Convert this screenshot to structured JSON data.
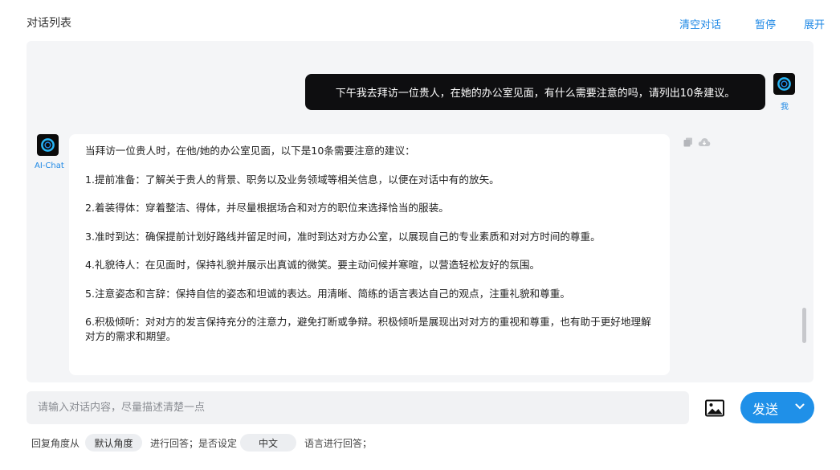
{
  "header": {
    "title": "对话列表",
    "actions": {
      "clear": "清空对话",
      "pause": "暂停",
      "expand": "展开"
    }
  },
  "chat": {
    "user": {
      "label": "我",
      "message": "下午我去拜访一位贵人，在她的办公室见面，有什么需要注意的吗，请列出10条建议。"
    },
    "ai": {
      "label": "AI-Chat",
      "paragraphs": [
        "当拜访一位贵人时，在他/她的办公室见面，以下是10条需要注意的建议：",
        "1.提前准备：了解关于贵人的背景、职务以及业务领域等相关信息，以便在对话中有的放矢。",
        "2.着装得体：穿着整洁、得体，并尽量根据场合和对方的职位来选择恰当的服装。",
        "3.准时到达：确保提前计划好路线并留足时间，准时到达对方办公室，以展现自己的专业素质和对对方时间的尊重。",
        "4.礼貌待人：在见面时，保持礼貌并展示出真诚的微笑。要主动问候并寒暄，以营造轻松友好的氛围。",
        "5.注意姿态和言辞：保持自信的姿态和坦诚的表达。用清晰、简练的语言表达自己的观点，注重礼貌和尊重。",
        "6.积极倾听：对对方的发言保持充分的注意力，避免打断或争辩。积极倾听是展现出对对方的重视和尊重，也有助于更好地理解对方的需求和期望。"
      ]
    },
    "icons": {
      "copy": "copy-icon",
      "download": "cloud-download-icon",
      "avatar": "ai-logo-icon"
    }
  },
  "input": {
    "placeholder": "请输入对话内容，尽量描述清楚一点",
    "value": ""
  },
  "send": {
    "label": "发送"
  },
  "options": {
    "prefix": "回复角度从",
    "angle": "默认角度",
    "middle": "进行回答；是否设定",
    "language": "中文",
    "suffix": "语言进行回答；"
  },
  "colors": {
    "accent": "#1f90e8",
    "link": "#1e88e5",
    "panel": "#f4f5f7",
    "bubble_dark": "#0e0e10"
  }
}
